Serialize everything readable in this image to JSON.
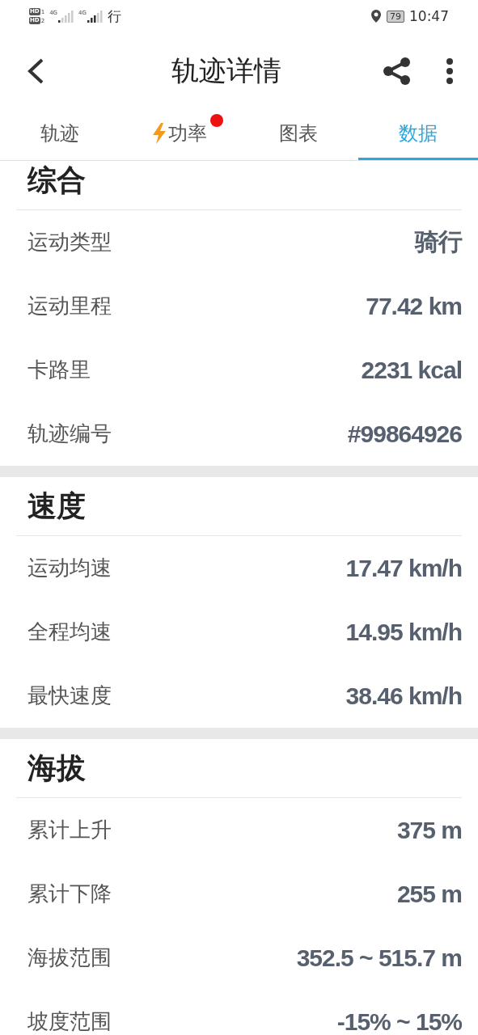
{
  "status_bar": {
    "sims": [
      {
        "label": "HD",
        "slot": "1"
      },
      {
        "label": "HD",
        "slot": "2"
      }
    ],
    "networks": [
      {
        "label": "4G"
      },
      {
        "label": "4G"
      }
    ],
    "carrier": "行",
    "battery": "79",
    "time": "10:47"
  },
  "header": {
    "title": "轨迹详情"
  },
  "tabs": [
    {
      "label": "轨迹",
      "selected": false,
      "kind": "text",
      "badge": false
    },
    {
      "label": "功率",
      "selected": false,
      "kind": "power",
      "badge": true
    },
    {
      "label": "图表",
      "selected": false,
      "kind": "text",
      "badge": false
    },
    {
      "label": "数据",
      "selected": true,
      "kind": "text",
      "badge": false
    }
  ],
  "sections": [
    {
      "title": "综合",
      "rows": [
        {
          "label": "运动类型",
          "value": "骑行"
        },
        {
          "label": "运动里程",
          "value": "77.42 km"
        },
        {
          "label": "卡路里",
          "value": "2231 kcal"
        },
        {
          "label": "轨迹编号",
          "value": "#99864926"
        }
      ]
    },
    {
      "title": "速度",
      "rows": [
        {
          "label": "运动均速",
          "value": "17.47 km/h"
        },
        {
          "label": "全程均速",
          "value": "14.95 km/h"
        },
        {
          "label": "最快速度",
          "value": "38.46 km/h"
        }
      ]
    },
    {
      "title": "海拔",
      "rows": [
        {
          "label": "累计上升",
          "value": "375 m"
        },
        {
          "label": "累计下降",
          "value": "255 m"
        },
        {
          "label": "海拔范围",
          "value": "352.5 ~ 515.7 m"
        },
        {
          "label": "坡度范围",
          "value": "-15% ~ 15%"
        }
      ]
    }
  ]
}
